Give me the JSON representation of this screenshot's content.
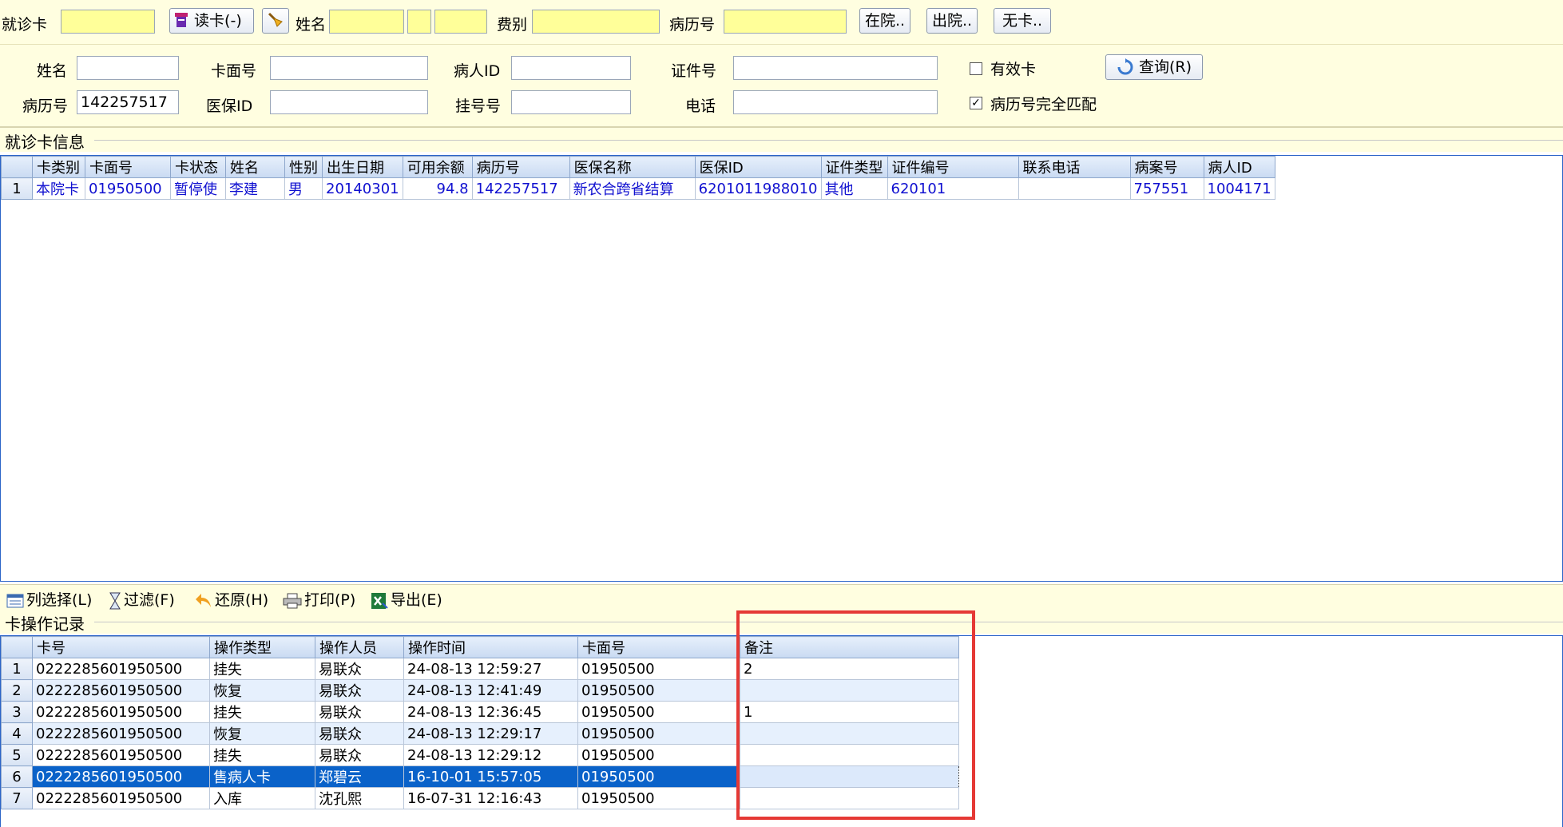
{
  "topbar": {
    "card_label": "就诊卡",
    "read_card_button": "读卡(-)",
    "name_label": "姓名",
    "fee_label": "费别",
    "record_label": "病历号",
    "in_hospital_button": "在院..",
    "out_hospital_button": "出院..",
    "no_card_button": "无卡.."
  },
  "filter": {
    "name_label": "姓名",
    "card_face_label": "卡面号",
    "patient_id_label": "病人ID",
    "id_no_label": "证件号",
    "valid_card_label": "有效卡",
    "record_no_label": "病历号",
    "record_no_value": "142257517",
    "insurance_id_label": "医保ID",
    "reg_no_label": "挂号号",
    "phone_label": "电话",
    "exact_match_label": "病历号完全匹配",
    "exact_match_check": "✓",
    "query_button": "查询(R)"
  },
  "card_info": {
    "title": "就诊卡信息",
    "columns": [
      "卡类别",
      "卡面号",
      "卡状态",
      "姓名",
      "性别",
      "出生日期",
      "可用余额",
      "病历号",
      "医保名称",
      "医保ID",
      "证件类型",
      "证件编号",
      "联系电话",
      "病案号",
      "病人ID"
    ],
    "rows": [
      [
        "1",
        "本院卡",
        "01950500",
        "暂停使",
        "李建",
        "男",
        "20140301",
        "94.8",
        "142257517",
        "新农合跨省结算",
        "6201011988010",
        "其他",
        "620101",
        "",
        "757551",
        "1004171"
      ]
    ]
  },
  "toolbar": {
    "column_select": "列选择(L)",
    "filter": "过滤(F)",
    "restore": "还原(H)",
    "print": "打印(P)",
    "export": "导出(E)"
  },
  "ops": {
    "title": "卡操作记录",
    "columns": [
      "卡号",
      "操作类型",
      "操作人员",
      "操作时间",
      "卡面号",
      "备注"
    ],
    "rows": [
      [
        "1",
        "0222285601950500",
        "挂失",
        "易联众",
        "24-08-13 12:59:27",
        "01950500",
        "2"
      ],
      [
        "2",
        "0222285601950500",
        "恢复",
        "易联众",
        "24-08-13 12:41:49",
        "01950500",
        ""
      ],
      [
        "3",
        "0222285601950500",
        "挂失",
        "易联众",
        "24-08-13 12:36:45",
        "01950500",
        "1"
      ],
      [
        "4",
        "0222285601950500",
        "恢复",
        "易联众",
        "24-08-13 12:29:17",
        "01950500",
        ""
      ],
      [
        "5",
        "0222285601950500",
        "挂失",
        "易联众",
        "24-08-13 12:29:12",
        "01950500",
        ""
      ],
      [
        "6",
        "0222285601950500",
        "售病人卡",
        "郑碧云",
        "16-10-01 15:57:05",
        "01950500",
        ""
      ],
      [
        "7",
        "0222285601950500",
        "入库",
        "沈孔熙",
        "16-07-31 12:16:43",
        "01950500",
        ""
      ]
    ],
    "selected_row": 6
  }
}
